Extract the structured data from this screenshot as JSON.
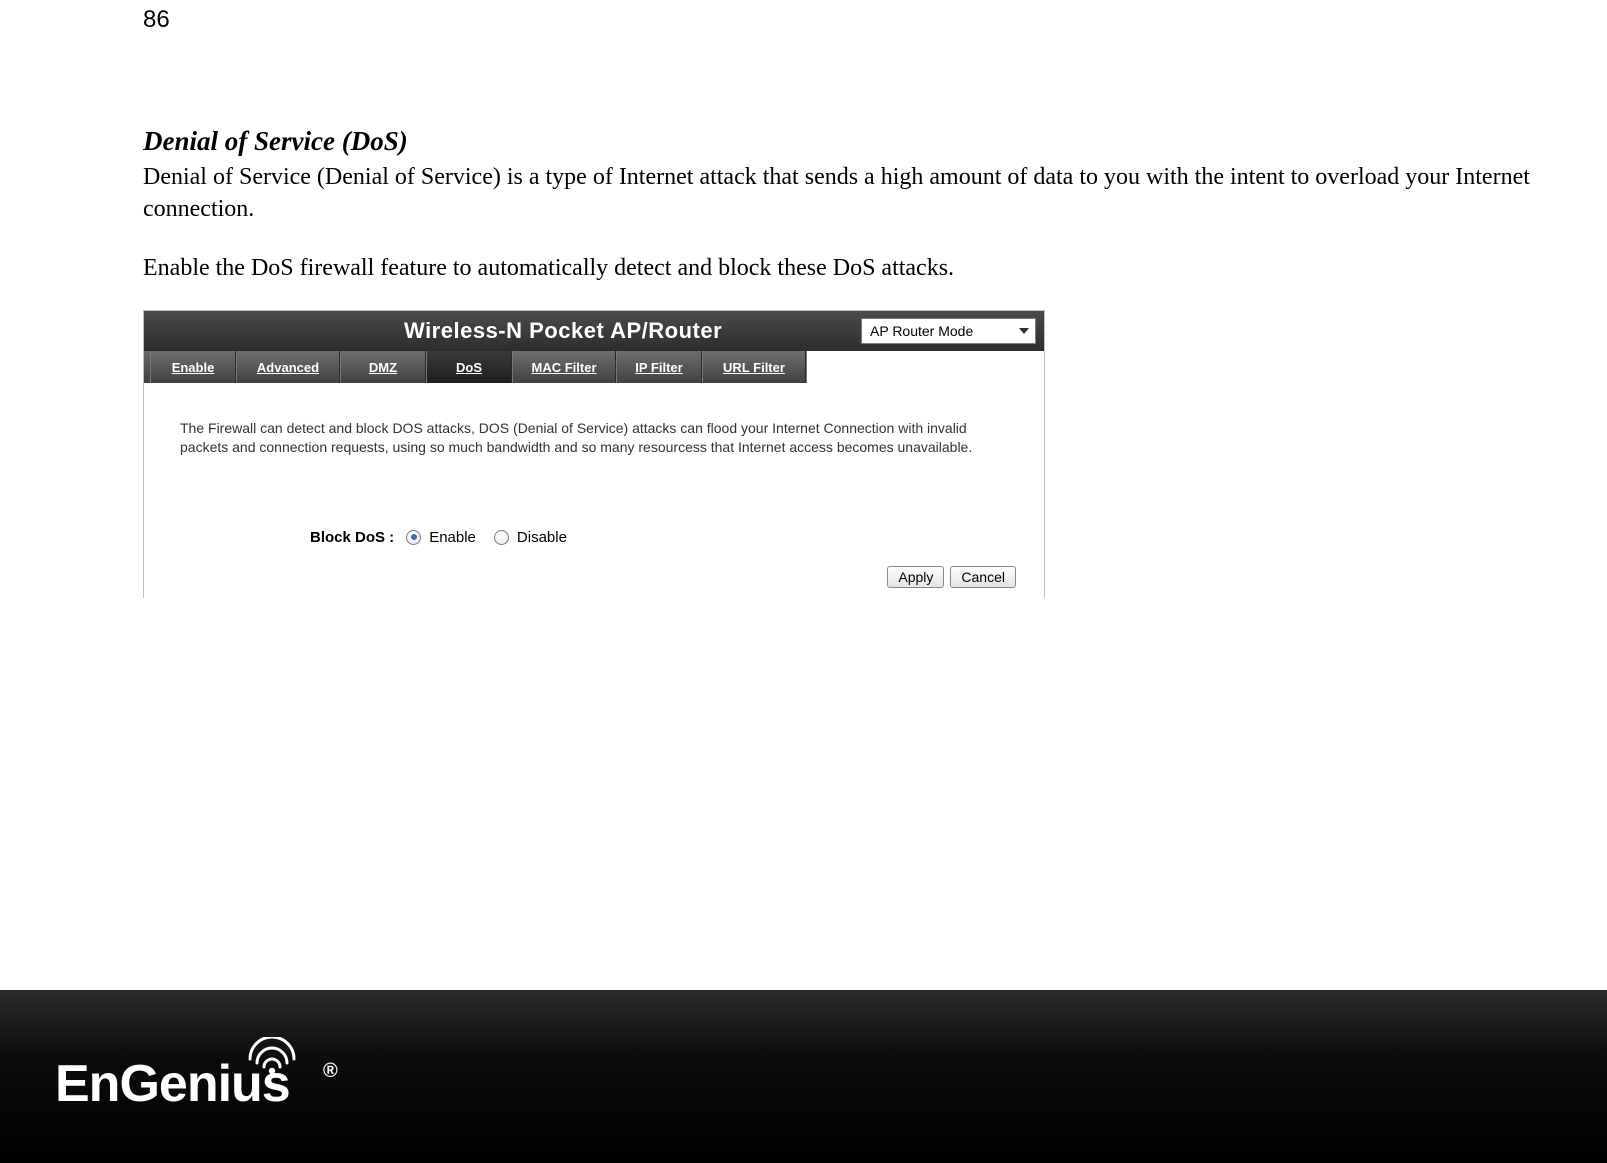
{
  "page_number": "86",
  "section_title": "Denial of Service (DoS)",
  "para1": "Denial of Service (Denial of Service) is a type of Internet attack that sends a high amount of data to you with the intent to overload your Internet connection.",
  "para2": "Enable the DoS firewall feature to automatically detect and block these DoS attacks.",
  "router": {
    "title": "Wireless-N Pocket AP/Router",
    "mode_selected": "AP Router Mode",
    "tabs": [
      "Enable",
      "Advanced",
      "DMZ",
      "DoS",
      "MAC Filter",
      "IP Filter",
      "URL Filter"
    ],
    "active_tab": "DoS",
    "description": "The Firewall can detect and block DOS attacks, DOS (Denial of Service) attacks can flood your Internet Connection with invalid packets and connection requests, using so much bandwidth and so many resourcess that Internet access becomes unavailable.",
    "form": {
      "label": "Block DoS :",
      "enable_label": "Enable",
      "disable_label": "Disable",
      "selected": "Enable"
    },
    "buttons": {
      "apply": "Apply",
      "cancel": "Cancel"
    }
  },
  "logo_text": "EnGenius",
  "logo_reg": "®"
}
